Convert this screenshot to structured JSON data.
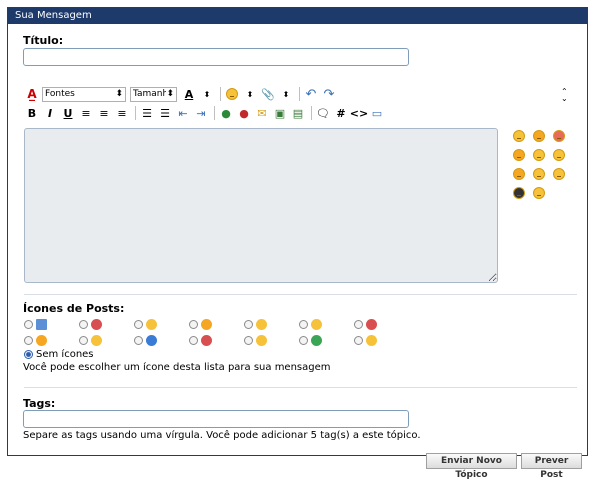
{
  "panel": {
    "title": "Sua Mensagem"
  },
  "title_field": {
    "label": "Título:",
    "value": ""
  },
  "toolbar": {
    "font_select": "Fontes",
    "size_select": "Tamanho",
    "bold": "B",
    "italic": "I",
    "underline": "U",
    "hash": "#",
    "code": "<>"
  },
  "editor": {
    "value": ""
  },
  "post_icons": {
    "label": "Ícones de Posts:",
    "no_icon_label": "Sem ícones",
    "help": "Você pode escolher um ícone desta lista para sua mensagem",
    "colors": [
      "#5b8fd6",
      "#d94f4f",
      "#f5c23a",
      "#f5a623",
      "#f5c23a",
      "#f5c23a",
      "#d94f4f",
      "#f5a623",
      "#f5c23a",
      "#3a7bd5",
      "#d94f4f",
      "#f5c23a",
      "#3aa655",
      "#f5c23a"
    ],
    "icons": [
      "document-icon",
      "thumbs-down-icon",
      "smile-icon",
      "grin-icon",
      "happy-icon",
      "sad-icon",
      "angry-icon",
      "wink-icon",
      "cool-icon",
      "question-icon",
      "exclamation-icon",
      "lightbulb-icon",
      "arrow-icon",
      "thumbs-up-icon"
    ]
  },
  "tags": {
    "label": "Tags:",
    "value": "",
    "help": "Separe as tags usando uma vírgula. Você pode adicionar 5 tag(s) a este tópico."
  },
  "buttons": {
    "submit": "Enviar Novo Tópico",
    "preview": "Prever Post"
  }
}
